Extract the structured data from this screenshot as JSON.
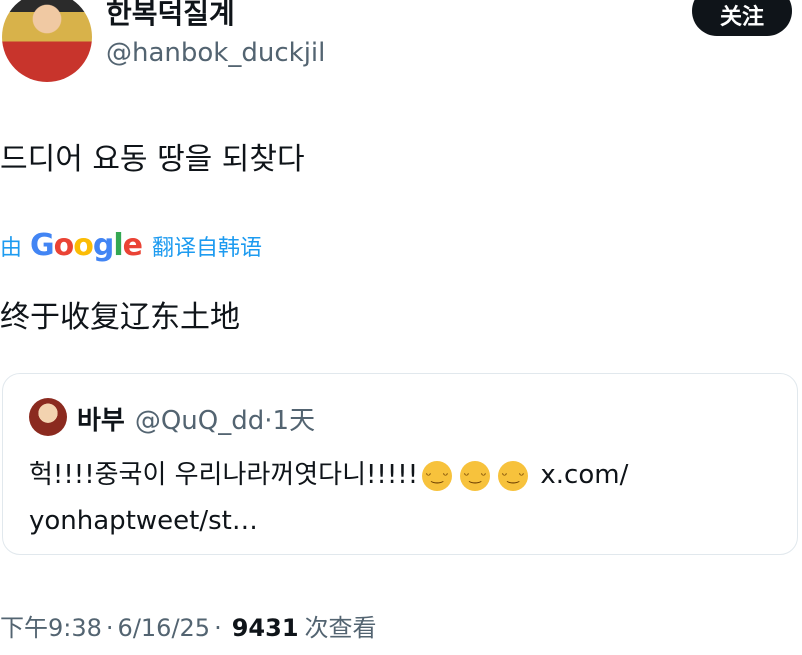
{
  "author": {
    "display_name": "한복덕질계",
    "handle": "@hanbok_duckjil",
    "follow_label": "关注"
  },
  "tweet": {
    "text": "드디어 요동 땅을 되찾다",
    "translation": {
      "by_label": "由",
      "google_logo": [
        "G",
        "o",
        "o",
        "g",
        "l",
        "e"
      ],
      "translate_link": "翻译自韩语",
      "translated_text": "终于收复辽东土地"
    }
  },
  "quoted_tweet": {
    "name": "바부",
    "handle": "@QuQ_dd",
    "separator": "·",
    "time": "1天",
    "text": "헉!!!!중국이 우리나라꺼엿다니!!!!!",
    "emojis": [
      "grinning-face-icon",
      "grinning-face-icon",
      "grinning-face-icon"
    ],
    "link_part1": "x.com/",
    "link_part2": "yonhaptweet/st…"
  },
  "meta": {
    "time": "下午9:38",
    "sep1": "·",
    "date": "6/16/25",
    "sep2": "·",
    "views": "9431",
    "views_label": "次查看"
  }
}
